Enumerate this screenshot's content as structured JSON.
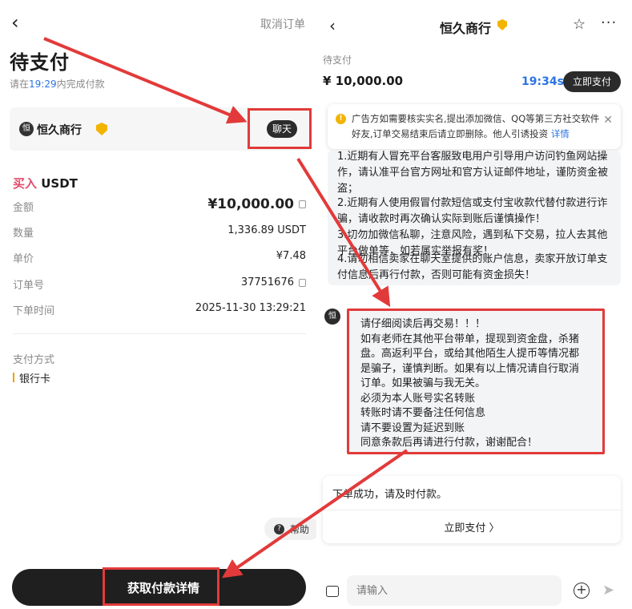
{
  "left": {
    "back_icon": "chevron-left-icon",
    "cancel_order": "取消订单",
    "title": "待支付",
    "deadline_prefix": "请在",
    "deadline_time": "19:29",
    "deadline_suffix": "内完成付款",
    "merchant_avatar": "恒",
    "merchant_name": "恒久商行",
    "chat_label": "聊天",
    "buy_word": "买入",
    "buy_asset": "USDT",
    "rows": [
      {
        "label": "金额",
        "value": "¥10,000.00"
      },
      {
        "label": "数量",
        "value": "1,336.89 USDT"
      },
      {
        "label": "单价",
        "value": "¥7.48"
      },
      {
        "label": "订单号",
        "value": "37751676"
      },
      {
        "label": "下单时间",
        "value": "2025-11-30 13:29:21"
      }
    ],
    "pay_method_label": "支付方式",
    "bank_name": "银行卡",
    "help_label": "帮助",
    "get_pay_details": "获取付款详情"
  },
  "right": {
    "title": "恒久商行",
    "status": "待支付",
    "amount": "¥ 10,000.00",
    "timer": "19:34s",
    "pay_now": "立即支付",
    "notice_text": "广告方如需要核实实名,提出添加微信、QQ等第三方社交软件好友,订单交易结束后请立即删除。他人引诱投资 ",
    "notice_link": "详情",
    "warnings": [
      "1.近期有人冒充平台客服致电用户引导用户访问钓鱼网站操作，请认准平台官方网址和官方认证邮件地址，谨防资金被盗；",
      "2.近期有人使用假冒付款短信或支付宝收款代替付款进行诈骗，请收款时再次确认实际到账后谨慎操作！",
      "3.切勿加微信私聊，注意风险，遇到私下交易，拉人去其他平台做单等，如若属实举报有奖！",
      "4.请勿相信卖家在聊天室提供的账户信息，卖家开放订单支付信息后再行付款，否则可能有资金损失！"
    ],
    "msg_avatar": "恒",
    "msg_lines": [
      "请仔细阅读后再交易！！！",
      "如有老师在其他平台带单，提现到资金盘，杀猪",
      "盘。高返利平台，或给其他陌生人提币等情况都",
      "是骗子，谨慎判断。如果有以上情况请自行取消",
      "订单。如果被骗与我无关。",
      "必须为本人账号实名转账",
      "转账时请不要备注任何信息",
      "请不要设置为延迟到账",
      "同意条款后再请进行付款，谢谢配合！"
    ],
    "order_msg": "下单成功，请及时付款。",
    "order_pay": "立即支付 〉",
    "input_placeholder": "请输入"
  },
  "colors": {
    "highlight_frame": "#e23a3a",
    "accent_blue": "#2c74e4",
    "buy_pink": "#e24c6b",
    "dark_button": "#2b2b2b"
  }
}
